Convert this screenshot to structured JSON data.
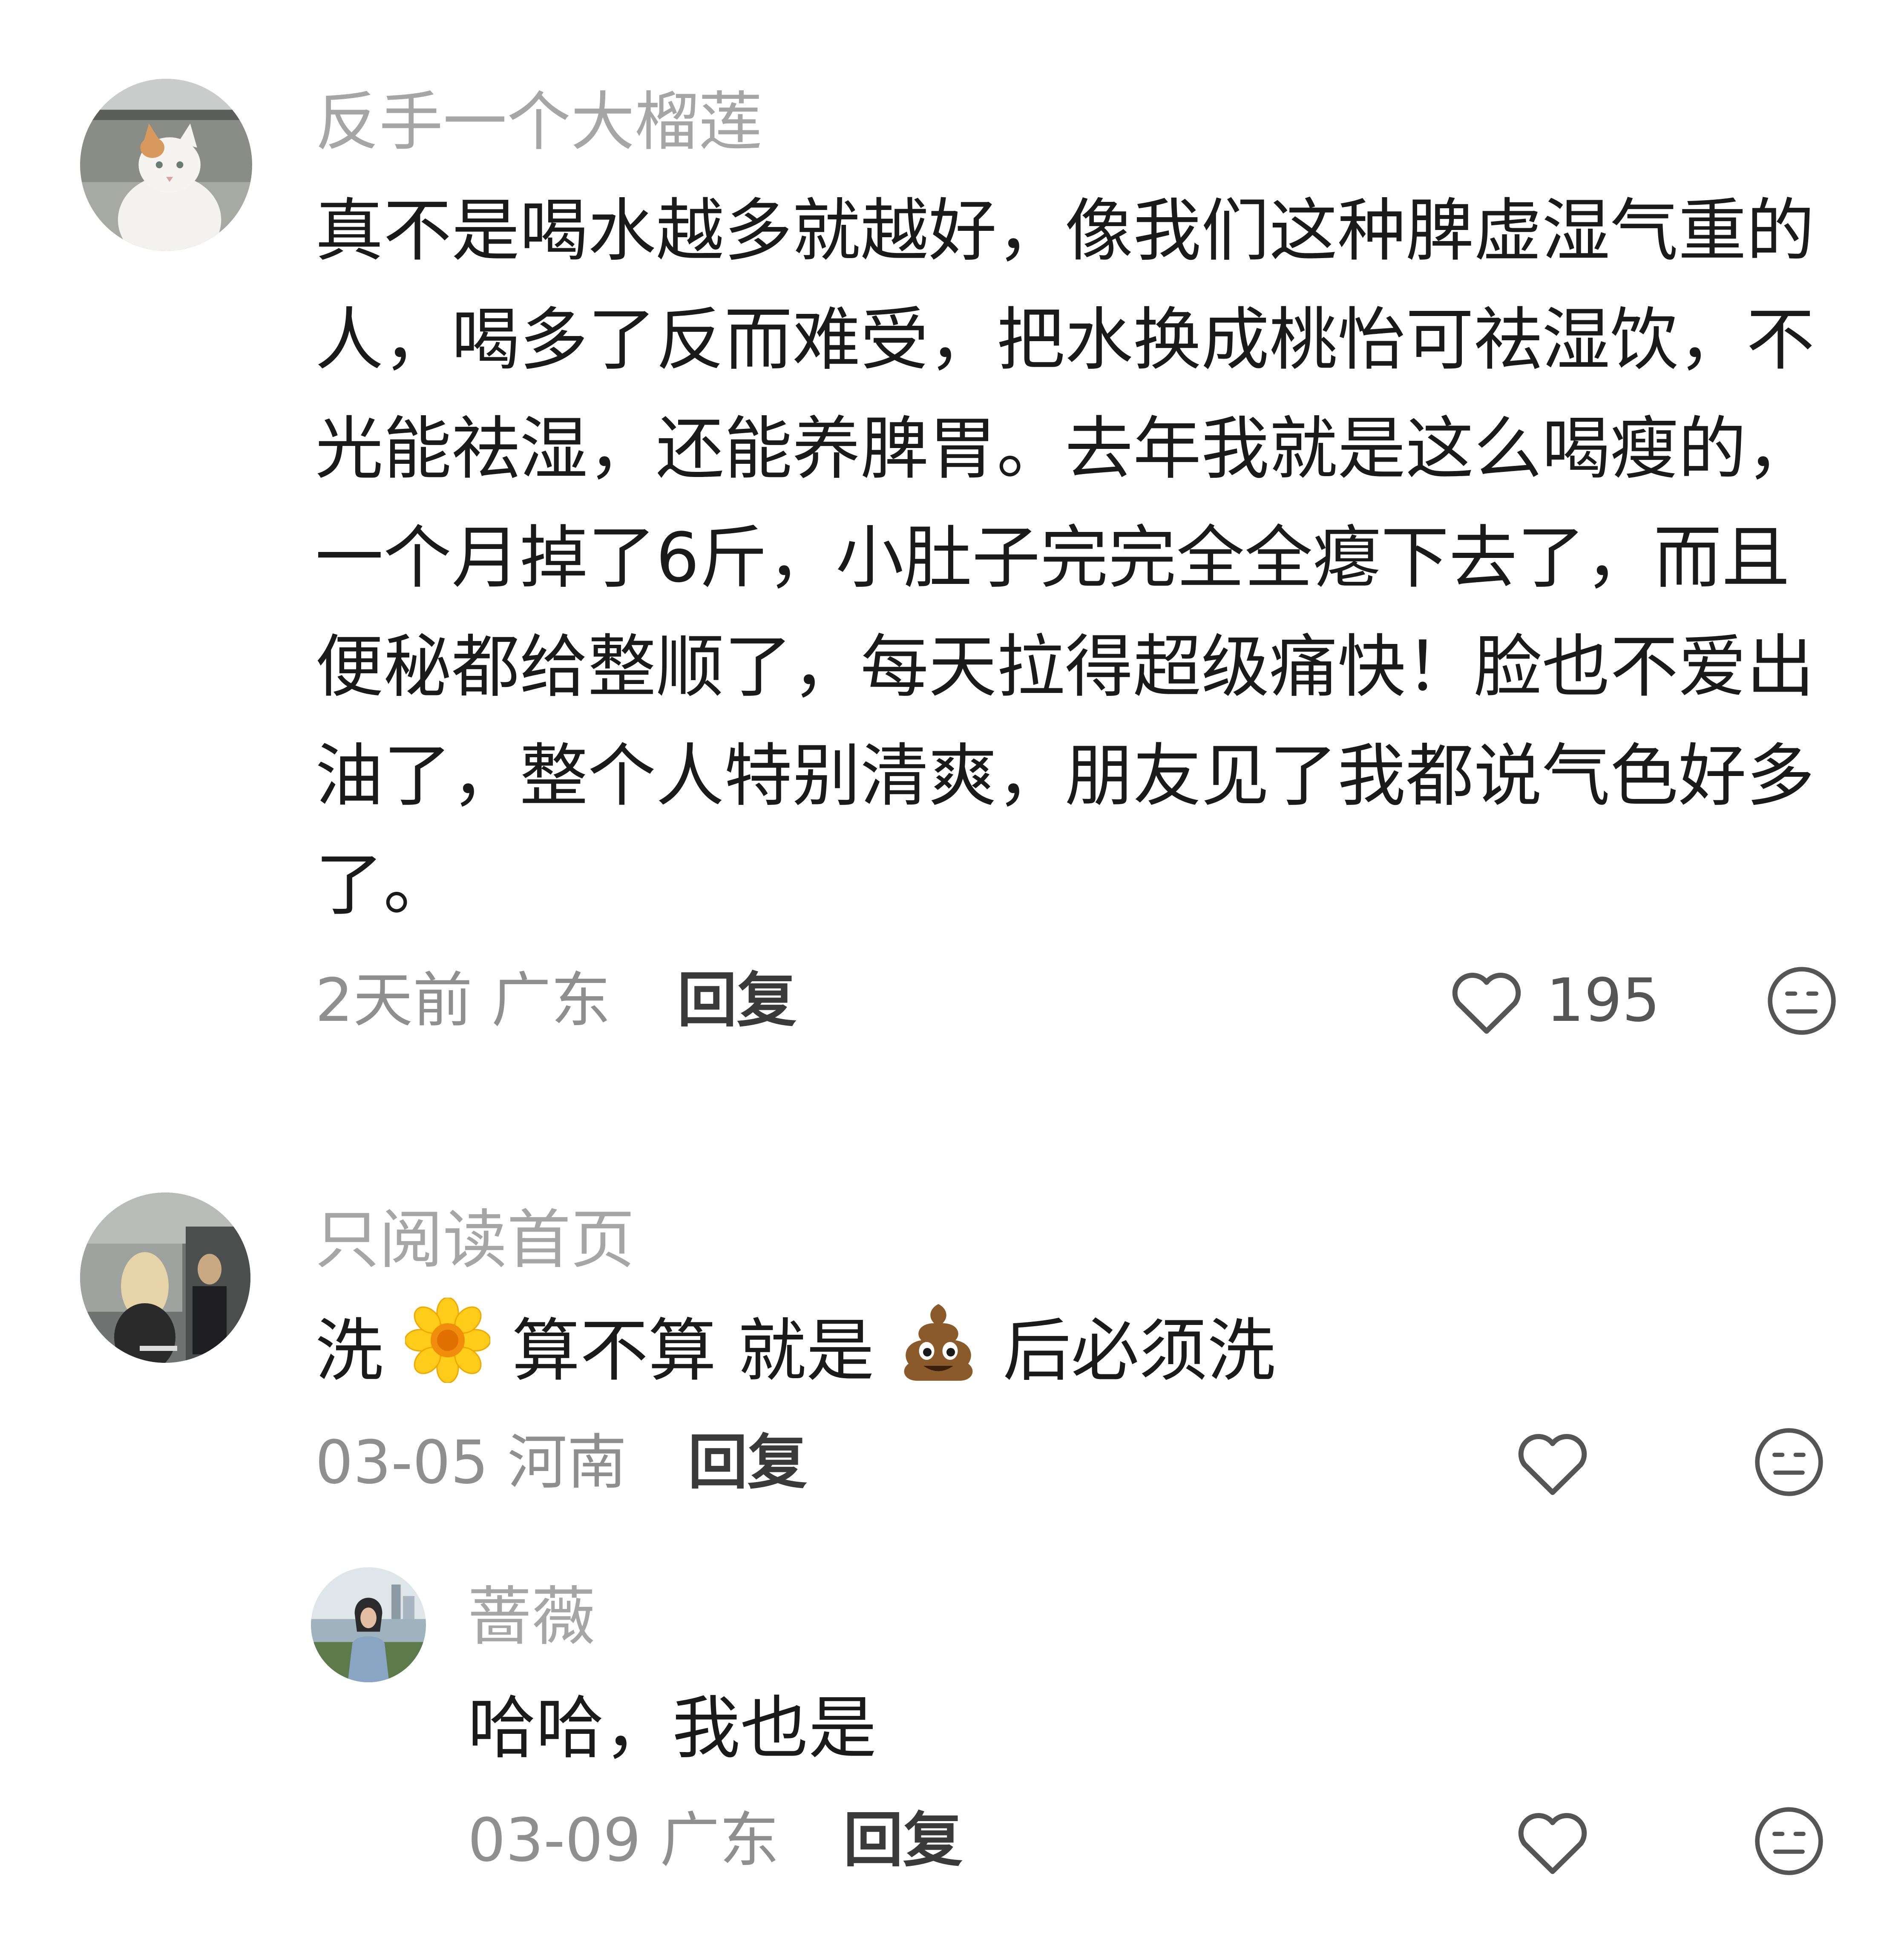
{
  "comments": [
    {
      "username": "反手一个大榴莲",
      "avatar_icon": "cat-avatar",
      "body_lines": [
        "真不是喝水越多就越好，像我们这种脾虚湿气重的",
        "人，喝多了反而难受，把水换成桃怡可祛湿饮，不",
        "光能祛湿，还能养脾胃。去年我就是这么喝瘦的，",
        "一个月掉了6斤，小肚子完完全全瘪下去了，而且",
        "便秘都给整顺了，每天拉得超级痛快！脸也不爱出",
        "油了，整个人特别清爽，朋友见了我都说气色好多",
        "了。"
      ],
      "date_location": "2天前 广东",
      "reply_label": "回复",
      "like_count": "195"
    },
    {
      "username": "只阅读首页",
      "avatar_icon": "movie-scene-avatar",
      "body_parts": [
        "洗",
        "算不算 就是",
        "后必须洗"
      ],
      "emojis": [
        "sunflower-emoji",
        "poop-emoji"
      ],
      "date_location": "03-05 河南",
      "reply_label": "回复",
      "like_count": ""
    },
    {
      "username": "蔷薇",
      "avatar_icon": "woman-photo-avatar",
      "body": "哈哈，我也是",
      "date_location": "03-09 广东",
      "reply_label": "回复",
      "like_count": ""
    }
  ],
  "icons": {
    "like": "heart-icon",
    "dislike": "neutral-face-icon"
  },
  "colors": {
    "username": "#a6a6a6",
    "text": "#1a1a1a",
    "meta": "#8f8f8f",
    "icon": "#555555"
  }
}
